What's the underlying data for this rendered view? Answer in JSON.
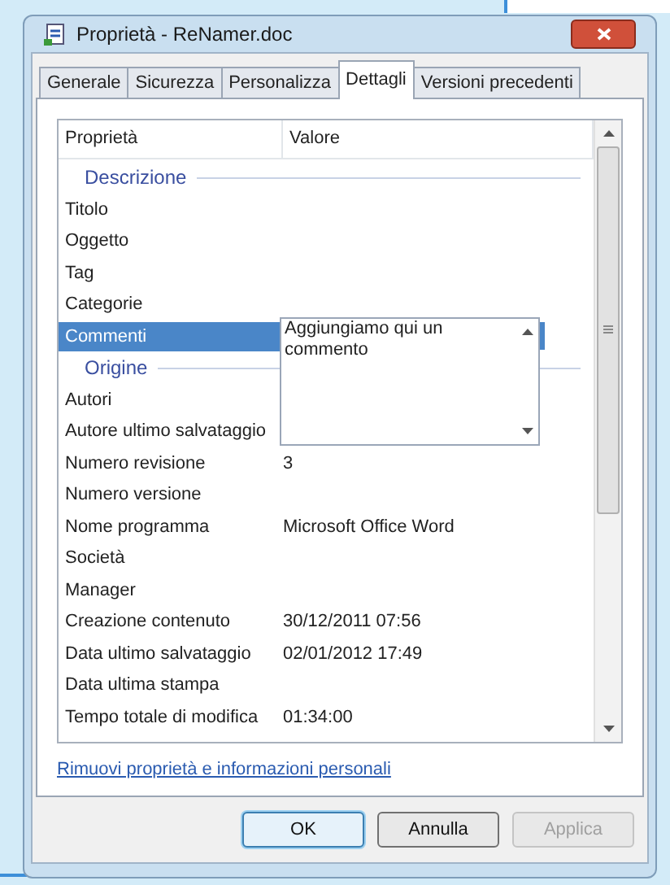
{
  "window": {
    "title": "Proprietà - ReNamer.doc"
  },
  "tabs": [
    {
      "label": "Generale",
      "selected": false
    },
    {
      "label": "Sicurezza",
      "selected": false
    },
    {
      "label": "Personalizza",
      "selected": false
    },
    {
      "label": "Dettagli",
      "selected": true
    },
    {
      "label": "Versioni precedenti",
      "selected": false
    }
  ],
  "table": {
    "columns": [
      "Proprietà",
      "Valore"
    ],
    "rows": [
      {
        "kind": "group",
        "label": "Descrizione"
      },
      {
        "kind": "property",
        "name": "Titolo",
        "selected": false
      },
      {
        "kind": "property",
        "name": "Oggetto",
        "selected": false
      },
      {
        "kind": "property",
        "name": "Tag",
        "selected": false
      },
      {
        "kind": "property",
        "name": "Categorie",
        "selected": false
      },
      {
        "kind": "property",
        "name": "Commenti",
        "selected": true,
        "editor": "Aggiungiamo qui un commento"
      },
      {
        "kind": "group",
        "label": "Origine"
      },
      {
        "kind": "property",
        "name": "Autori",
        "selected": false
      },
      {
        "kind": "property",
        "name": "Autore ultimo salvataggio",
        "selected": false
      },
      {
        "kind": "property",
        "name": "Numero revisione",
        "value": "3",
        "selected": false
      },
      {
        "kind": "property",
        "name": "Numero versione",
        "selected": false
      },
      {
        "kind": "property",
        "name": "Nome programma",
        "value": "Microsoft Office Word",
        "selected": false
      },
      {
        "kind": "property",
        "name": "Società",
        "selected": false
      },
      {
        "kind": "property",
        "name": "Manager",
        "selected": false
      },
      {
        "kind": "property",
        "name": "Creazione contenuto",
        "value": "30/12/2011 07:56",
        "selected": false
      },
      {
        "kind": "property",
        "name": "Data ultimo salvataggio",
        "value": "02/01/2012 17:49",
        "selected": false
      },
      {
        "kind": "property",
        "name": "Data ultima stampa",
        "selected": false
      },
      {
        "kind": "property",
        "name": "Tempo totale di modifica",
        "value": "01:34:00",
        "selected": false
      }
    ]
  },
  "link": "Rimuovi proprietà e informazioni personali",
  "buttons": [
    {
      "label": "OK",
      "kind": "default",
      "disabled": false
    },
    {
      "label": "Annulla",
      "kind": "normal",
      "disabled": false
    },
    {
      "label": "Applica",
      "kind": "normal",
      "disabled": true
    }
  ]
}
